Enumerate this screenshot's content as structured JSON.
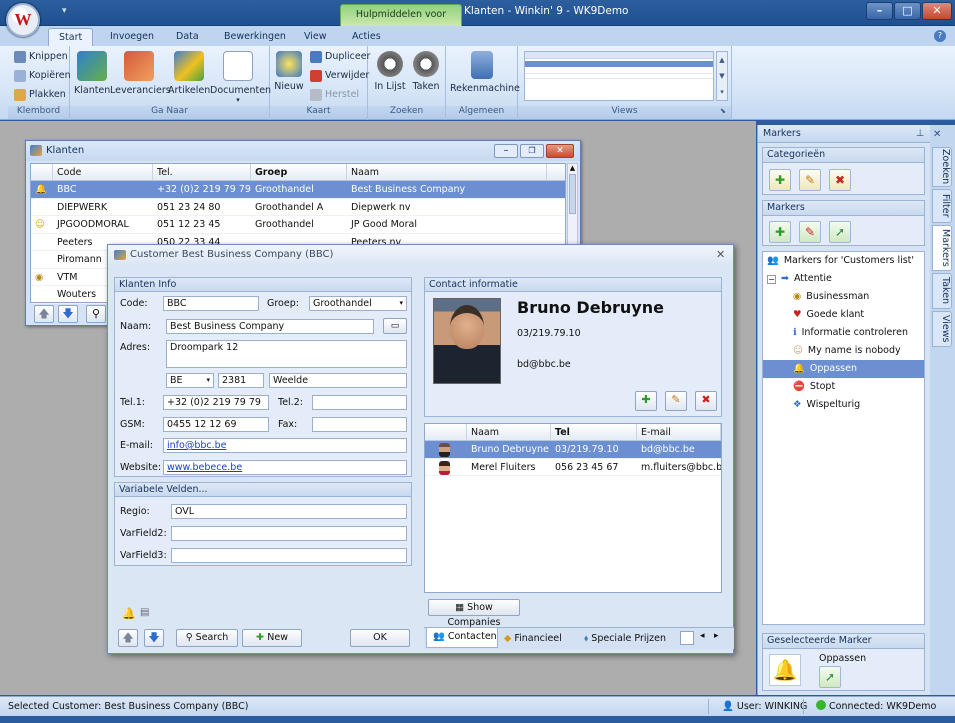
{
  "app": {
    "title": "Klanten - Winkin' 9 - WK9Demo",
    "context_tab": "Hulpmiddelen voor Klanten",
    "logo_letter": "W"
  },
  "ribbon_tabs": [
    "Start",
    "Invoegen",
    "Data",
    "Bewerkingen",
    "View",
    "Acties"
  ],
  "ribbon": {
    "klembord": {
      "label": "Klembord",
      "knippen": "Knippen",
      "kopieren": "Kopiëren",
      "plakken": "Plakken"
    },
    "ganaar": {
      "label": "Ga Naar",
      "klanten": "Klanten",
      "leveranciers": "Leveranciers",
      "artikelen": "Artikelen",
      "documenten": "Documenten"
    },
    "kaart": {
      "label": "Kaart",
      "nieuw": "Nieuw",
      "dupliceer": "Dupliceer",
      "verwijder": "Verwijder",
      "herstel": "Herstel"
    },
    "zoeken": {
      "label": "Zoeken",
      "inlijst": "In Lijst",
      "taken": "Taken"
    },
    "algemeen": {
      "label": "Algemeen",
      "rekenmachine": "Rekenmachine"
    },
    "views": {
      "label": "Views"
    }
  },
  "klanten_window": {
    "title": "Klanten",
    "columns": [
      "Code",
      "Tel.",
      "Groep",
      "Naam"
    ],
    "rows": [
      {
        "code": "BBC",
        "tel": "+32 (0)2 219 79 79",
        "groep": "Groothandel",
        "naam": "Best Business Company"
      },
      {
        "code": "DIEPWERK",
        "tel": "051 23 24 80",
        "groep": "Groothandel A",
        "naam": "Diepwerk nv"
      },
      {
        "code": "JPGOODMORAL",
        "tel": "051 12 23 45",
        "groep": "Groothandel",
        "naam": "JP Good Moral"
      },
      {
        "code": "Peeters",
        "tel": "050 22 33 44",
        "groep": "",
        "naam": "Peeters nv"
      },
      {
        "code": "Piromann",
        "tel": "",
        "groep": "",
        "naam": ""
      },
      {
        "code": "VTM",
        "tel": "",
        "groep": "",
        "naam": ""
      },
      {
        "code": "Wouters",
        "tel": "",
        "groep": "",
        "naam": ""
      }
    ]
  },
  "customer_dialog": {
    "title": "Customer Best Business Company (BBC)",
    "info_header": "Klanten Info",
    "labels": {
      "code": "Code:",
      "groep": "Groep:",
      "naam": "Naam:",
      "adres": "Adres:",
      "tel1": "Tel.1:",
      "tel2": "Tel.2:",
      "gsm": "GSM:",
      "fax": "Fax:",
      "email": "E-mail:",
      "website": "Website:"
    },
    "values": {
      "code": "BBC",
      "groep": "Groothandel",
      "naam": "Best Business Company",
      "adres": "Droompark 12",
      "country": "BE",
      "postcode": "2381",
      "city": "Weelde",
      "tel1": "+32 (0)2 219 79 79",
      "tel2": "",
      "gsm": "0455 12 12 69",
      "fax": "",
      "email": "info@bbc.be",
      "website": "www.bebece.be"
    },
    "var_header": "Variabele Velden...",
    "var_labels": {
      "regio": "Regio:",
      "var2": "VarField2:",
      "var3": "VarField3:"
    },
    "var_values": {
      "regio": "OVL",
      "var2": "",
      "var3": ""
    },
    "contact_header": "Contact informatie",
    "contact": {
      "name": "Bruno Debruyne",
      "tel": "03/219.79.10",
      "email": "bd@bbc.be"
    },
    "contact_columns": [
      "Naam",
      "Tel",
      "E-mail"
    ],
    "contacts": [
      {
        "naam": "Bruno Debruyne",
        "tel": "03/219.79.10",
        "email": "bd@bbc.be"
      },
      {
        "naam": "Merel Fluiters",
        "tel": "056 23 45 67",
        "email": "m.fluiters@bbc.be"
      }
    ],
    "show_companies": "Show Companies",
    "search": "Search",
    "new": "New",
    "ok": "OK",
    "bottom_tabs": [
      "Contacten",
      "Financieel",
      "Speciale Prijzen"
    ]
  },
  "markers_pane": {
    "title": "Markers",
    "categories_header": "Categorieën",
    "markers_header": "Markers",
    "tree_title": "Markers for 'Customers list'",
    "tree_root": "Attentie",
    "tree_items": [
      "Businessman",
      "Goede klant",
      "Informatie controleren",
      "My name is nobody",
      "Oppassen",
      "Stopt",
      "Wispelturig"
    ],
    "selected_header": "Geselecteerde Marker",
    "selected_name": "Oppassen"
  },
  "side_tabs": [
    "Zoeken",
    "Filter",
    "Markers",
    "Taken",
    "Views"
  ],
  "status": {
    "left": "Selected Customer: Best Business Company (BBC)",
    "user": "User: WINKING",
    "connected": "Connected: WK9Demo"
  }
}
